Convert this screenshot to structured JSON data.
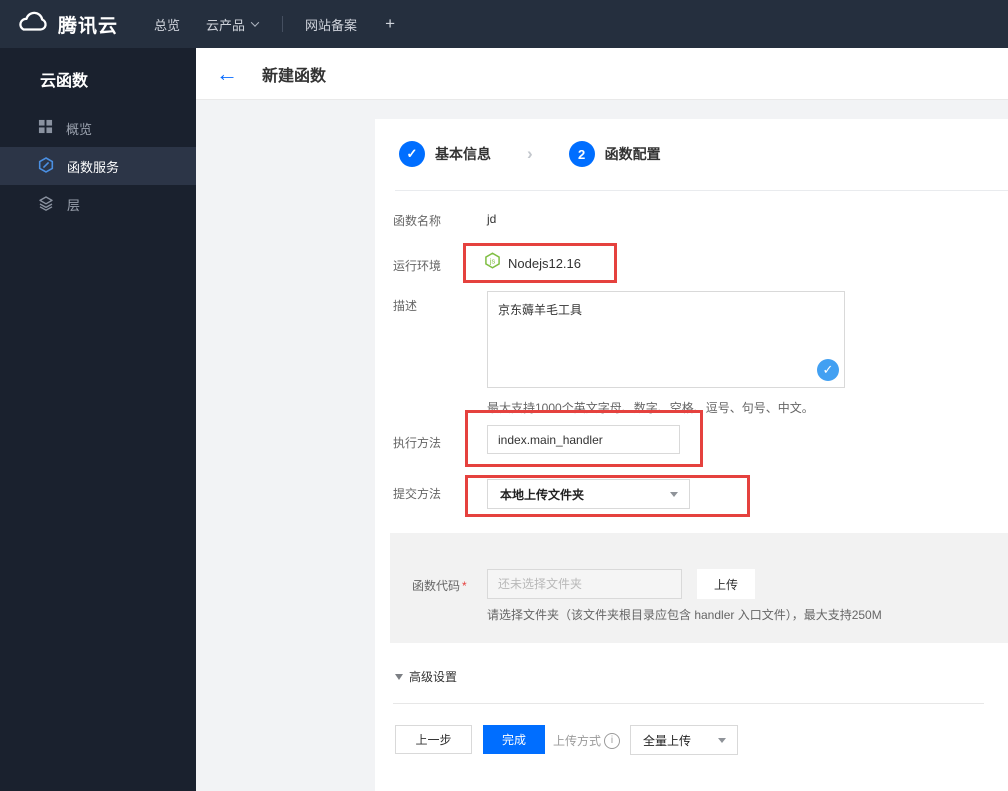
{
  "colors": {
    "accent_blue": "#006eff",
    "check_blue": "#42a0f2",
    "annotation_red": "#e5413e",
    "node_green": "#7fbe42",
    "navbar_bg": "#252f3e",
    "sidebar_bg": "#1a212e"
  },
  "topnav": {
    "brand": "腾讯云",
    "items": [
      {
        "label": "总览"
      },
      {
        "label": "云产品"
      },
      {
        "label": "网站备案"
      }
    ],
    "plus": "+"
  },
  "sidebar": {
    "title": "云函数",
    "items": [
      {
        "label": "概览",
        "icon": "grid-icon",
        "active": false
      },
      {
        "label": "函数服务",
        "icon": "function-hexagon-icon",
        "active": true
      },
      {
        "label": "层",
        "icon": "layers-icon",
        "active": false
      }
    ]
  },
  "header": {
    "title": "新建函数"
  },
  "steps": {
    "step1": {
      "label": "基本信息",
      "state": "done",
      "icon": "check-icon"
    },
    "step2": {
      "number": "2",
      "label": "函数配置",
      "state": "current"
    }
  },
  "form": {
    "name": {
      "label": "函数名称",
      "value": "jd"
    },
    "runtime": {
      "label": "运行环境",
      "value": "Nodejs12.16",
      "icon": "nodejs-hexagon-icon"
    },
    "description": {
      "label": "描述",
      "value": "京东薅羊毛工具",
      "hint": "最大支持1000个英文字母、数字、空格、逗号、句号、中文。"
    },
    "handler": {
      "label": "执行方法",
      "value": "index.main_handler"
    },
    "submit_method": {
      "label": "提交方法",
      "value": "本地上传文件夹"
    },
    "code": {
      "label": "函数代码",
      "required_mark": "*",
      "placeholder": "还未选择文件夹",
      "upload_button": "上传",
      "hint": "请选择文件夹（该文件夹根目录应包含 handler 入口文件），最大支持250M"
    },
    "advanced_label": "高级设置"
  },
  "footer": {
    "prev": "上一步",
    "finish": "完成",
    "upload_mode_label": "上传方式",
    "upload_mode_value": "全量上传"
  }
}
